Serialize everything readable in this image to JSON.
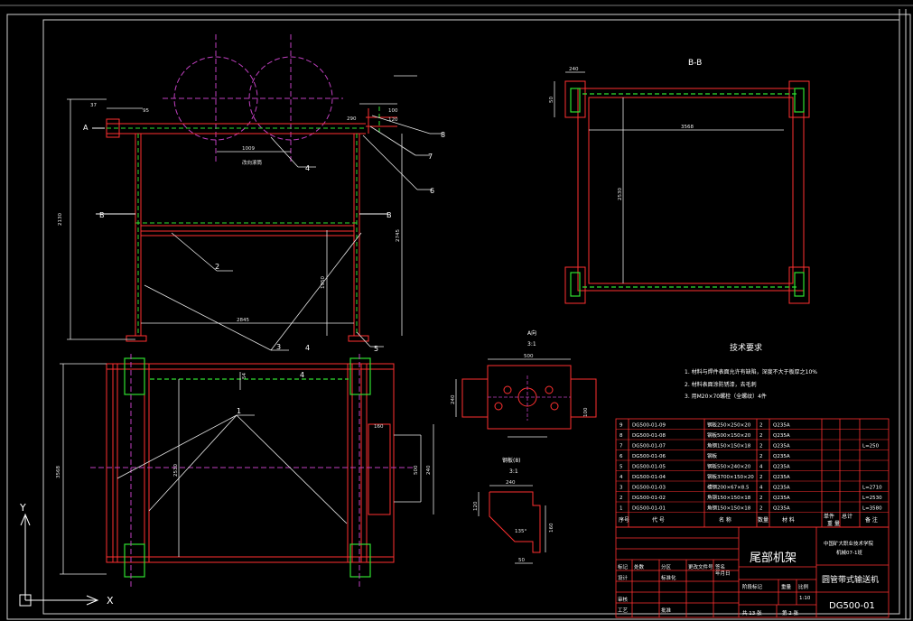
{
  "drawing": {
    "section_bb": "B-B",
    "section_a": "A",
    "section_b": "B",
    "dims": {
      "d37": "37",
      "d95": "95",
      "d1009": "1009",
      "d290": "290",
      "d2745": "2745",
      "d2130": "2130",
      "d1950": "1950",
      "d2845": "2845",
      "d3568": "3568",
      "d2530": "2530",
      "d500": "500",
      "d240": "240",
      "d160": "160",
      "d120": "120",
      "d100": "100",
      "d54": "54",
      "d50": "50"
    },
    "carrier_label": "改向滚筒",
    "callouts": [
      "1",
      "2",
      "3",
      "4",
      "5",
      "6",
      "7",
      "8"
    ],
    "detail_a_title": "A向",
    "detail_a_scale": "3:1",
    "detail_plate_title": "钢板(8)",
    "detail_plate_scale": "3:1",
    "angle": "135°",
    "axis_y": "Y",
    "axis_x": "X"
  },
  "tech": {
    "title": "技术要求",
    "items": [
      "1. 材料与焊件表面允许有缺陷，深度不大于板厚之10%",
      "2. 材料表面涂防锈漆，去毛刺",
      "3. 用M20×70螺栓（全螺纹）4件"
    ]
  },
  "bom": {
    "rows": [
      {
        "no": "9",
        "code": "DG500-01-09",
        "name": "钢板250×250×20",
        "qty": "2",
        "mat": "Q235A",
        "note": ""
      },
      {
        "no": "8",
        "code": "DG500-01-08",
        "name": "钢板500×150×20",
        "qty": "2",
        "mat": "Q235A",
        "note": ""
      },
      {
        "no": "7",
        "code": "DG500-01-07",
        "name": "角钢150×150×18",
        "qty": "2",
        "mat": "Q235A",
        "note": "L=250"
      },
      {
        "no": "6",
        "code": "DG500-01-06",
        "name": "钢板",
        "qty": "2",
        "mat": "Q235A",
        "note": ""
      },
      {
        "no": "5",
        "code": "DG500-01-05",
        "name": "钢板550×240×20",
        "qty": "4",
        "mat": "Q235A",
        "note": ""
      },
      {
        "no": "4",
        "code": "DG500-01-04",
        "name": "钢板3700×150×20",
        "qty": "2",
        "mat": "Q235A",
        "note": ""
      },
      {
        "no": "3",
        "code": "DG500-01-03",
        "name": "槽钢200×67×8.5",
        "qty": "4",
        "mat": "Q235A",
        "note": "L=2710"
      },
      {
        "no": "2",
        "code": "DG500-01-02",
        "name": "角钢150×150×18",
        "qty": "2",
        "mat": "Q235A",
        "note": "L=2530"
      },
      {
        "no": "1",
        "code": "DG500-01-01",
        "name": "角钢150×150×18",
        "qty": "2",
        "mat": "Q235A",
        "note": "L=3580"
      }
    ],
    "headers": {
      "no": "序号",
      "code": "代 号",
      "name": "名 称",
      "qty": "数量",
      "mat": "材 料",
      "weight_single": "单件",
      "weight_total": "总计",
      "weight": "重 量",
      "note": "备 注"
    }
  },
  "title_block": {
    "part_name": "尾部机架",
    "org": "中国矿大职业技术学院",
    "org_sub": "机械07-1班",
    "product": "圆管带式输送机",
    "drawing_no": "DG500-01",
    "scale_label": "比例",
    "scale": "1:10",
    "weight_label": "重量",
    "stage_label": "阶段标记",
    "sheets": "共 13 张",
    "sheet": "第 2 张",
    "rows": [
      "标记",
      "处数",
      "分区",
      "更改文件号",
      "签名",
      "年月日"
    ],
    "roles": [
      "设计",
      "标准化",
      "审核",
      "工艺",
      "批准"
    ]
  }
}
